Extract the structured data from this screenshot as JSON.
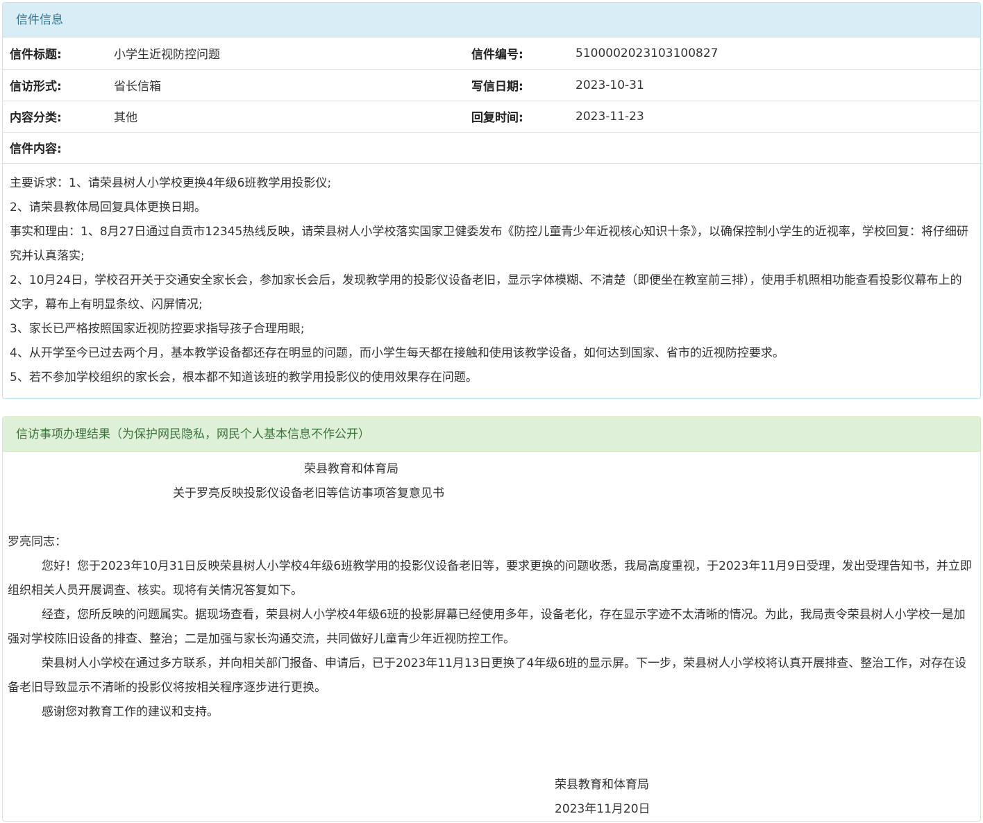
{
  "letter_panel": {
    "heading": "信件信息",
    "rows": [
      {
        "label1": "信件标题:",
        "value1": "小学生近视防控问题",
        "label2": "信件编号:",
        "value2": "5100002023103100827"
      },
      {
        "label1": "信访形式:",
        "value1": "省长信箱",
        "label2": "写信日期:",
        "value2": "2023-10-31"
      },
      {
        "label1": "内容分类:",
        "value1": "其他",
        "label2": "回复时间:",
        "value2": "2023-11-23"
      }
    ],
    "content_label": "信件内容:",
    "content_lines": [
      "主要诉求：1、请荣县树人小学校更换4年级6班教学用投影仪;",
      "2、请荣县教体局回复具体更换日期。",
      "事实和理由：1、8月27日通过自贡市12345热线反映，请荣县树人小学校落实国家卫健委发布《防控儿童青少年近视核心知识十条》，以确保控制小学生的近视率，学校回复：将仔细研究并认真落实;",
      "2、10月24日，学校召开关于交通安全家长会，参加家长会后，发现教学用的投影仪设备老旧，显示字体模糊、不清楚（即便坐在教室前三排），使用手机照相功能查看投影仪幕布上的文字，幕布上有明显条纹、闪屏情况;",
      "3、家长已严格按照国家近视防控要求指导孩子合理用眼;",
      "4、从开学至今已过去两个月，基本教学设备都还存在明显的问题，而小学生每天都在接触和使用该教学设备，如何达到国家、省市的近视防控要求。",
      "5、若不参加学校组织的家长会，根本都不知道该班的教学用投影仪的使用效果存在问题。"
    ]
  },
  "result_panel": {
    "heading": "信访事项办理结果（为保护网民隐私，网民个人基本信息不作公开）",
    "org_title": "荣县教育和体育局",
    "doc_title": "关于罗亮反映投影仪设备老旧等信访事项答复意见书",
    "salutation": "罗亮同志：",
    "paragraphs": [
      "您好！您于2023年10月31日反映荣县树人小学校4年级6班教学用的投影仪设备老旧等，要求更换的问题收悉，我局高度重视，于2023年11月9日受理，发出受理告知书，并立即组织相关人员开展调查、核实。现将有关情况答复如下。",
      "经查，您所反映的问题属实。据现场查看，荣县树人小学校4年级6班的投影屏幕已经使用多年，设备老化，存在显示字迹不太清晰的情况。为此，我局责令荣县树人小学校一是加强对学校陈旧设备的排查、整治；二是加强与家长沟通交流，共同做好儿童青少年近视防控工作。",
      "荣县树人小学校在通过多方联系，并向相关部门报备、申请后，已于2023年11月13日更换了4年级6班的显示屏。下一步，荣县树人小学校将认真开展排查、整治工作，对存在设备老旧导致显示不清晰的投影仪将按相关程序逐步进行更换。",
      "感谢您对教育工作的建议和支持。"
    ],
    "signature_org": "荣县教育和体育局",
    "signature_date": "2023年11月20日"
  }
}
